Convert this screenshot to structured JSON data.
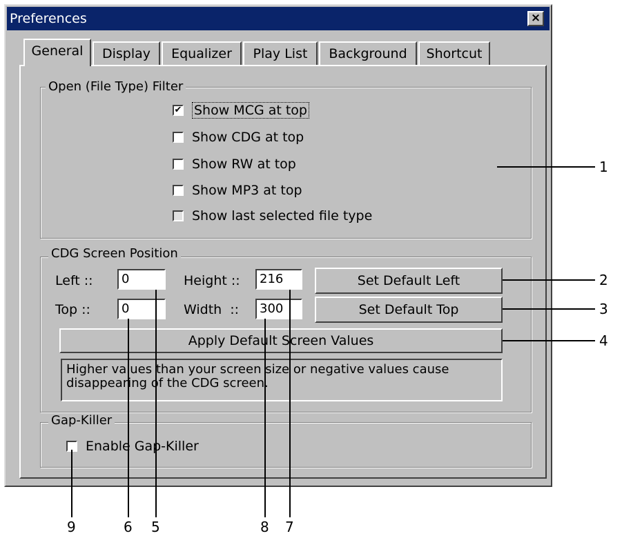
{
  "window": {
    "title": "Preferences",
    "close_label": "×"
  },
  "tabs": [
    {
      "label": "General"
    },
    {
      "label": "Display"
    },
    {
      "label": "Equalizer"
    },
    {
      "label": "Play List"
    },
    {
      "label": "Background"
    },
    {
      "label": "Shortcut"
    }
  ],
  "filter_group": {
    "title": "Open (File Type) Filter",
    "options": [
      {
        "label": "Show MCG at top",
        "checked": true
      },
      {
        "label": "Show CDG at top",
        "checked": false
      },
      {
        "label": "Show RW at top",
        "checked": false
      },
      {
        "label": "Show MP3 at top",
        "checked": false
      },
      {
        "label": "Show last selected file type",
        "checked": false
      }
    ]
  },
  "cdg_group": {
    "title": "CDG Screen Position",
    "left_label": "Left ::",
    "left_value": "0",
    "top_label": "Top ::",
    "top_value": "0",
    "height_label": "Height ::",
    "height_value": "216",
    "width_label": "Width  ::",
    "width_value": "300",
    "set_left_button": "Set Default Left",
    "set_top_button": "Set Default Top",
    "apply_button": "Apply Default Screen Values",
    "note": "Higher values than your screen size or negative values cause disappearing of the CDG screen."
  },
  "gap_group": {
    "title": "Gap-Killer",
    "enable_label": "Enable Gap-Killer",
    "checked": false
  },
  "callouts": [
    "1",
    "2",
    "3",
    "4",
    "5",
    "6",
    "7",
    "8",
    "9"
  ],
  "colors": {
    "titlebar": "#0a246a",
    "face": "#c0c0c0"
  }
}
